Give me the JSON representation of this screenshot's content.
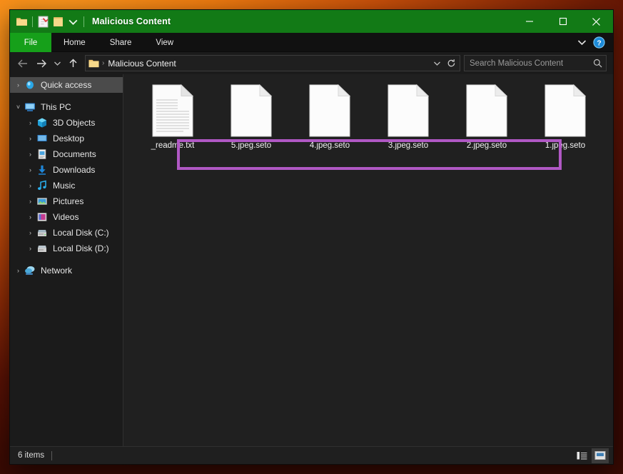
{
  "window": {
    "title": "Malicious Content",
    "accent_color": "#127a16",
    "quick_access_icons": [
      "folder-icon",
      "properties-icon",
      "new-folder-icon",
      "customize-chevron-icon"
    ],
    "controls": {
      "minimize": "minimize-icon",
      "maximize": "maximize-icon",
      "close": "close-icon"
    }
  },
  "ribbon": {
    "file_tab": "File",
    "tabs": [
      "Home",
      "Share",
      "View"
    ],
    "collapse_icon": "chevron-down-icon",
    "help_icon": "help-icon"
  },
  "addressbar": {
    "back_icon": "back-arrow-icon",
    "forward_icon": "forward-arrow-icon",
    "recent_icon": "recent-locations-chevron-icon",
    "up_icon": "up-arrow-icon",
    "folder_icon": "folder-icon",
    "crumb_separator": "›",
    "path": "Malicious Content",
    "dropdown_icon": "chevron-down-icon",
    "refresh_icon": "refresh-icon"
  },
  "search": {
    "placeholder": "Search Malicious Content",
    "icon": "search-icon"
  },
  "sidebar": {
    "items": [
      {
        "label": "Quick access",
        "icon": "quick-access-icon",
        "level": 1,
        "expander": "›",
        "selected": true
      },
      {
        "label": "This PC",
        "icon": "this-pc-icon",
        "level": 1,
        "expander": "˅",
        "selected": false
      },
      {
        "label": "3D Objects",
        "icon": "3d-objects-icon",
        "level": 2,
        "expander": "›",
        "selected": false
      },
      {
        "label": "Desktop",
        "icon": "desktop-icon",
        "level": 2,
        "expander": "›",
        "selected": false
      },
      {
        "label": "Documents",
        "icon": "documents-icon",
        "level": 2,
        "expander": "›",
        "selected": false
      },
      {
        "label": "Downloads",
        "icon": "downloads-icon",
        "level": 2,
        "expander": "›",
        "selected": false
      },
      {
        "label": "Music",
        "icon": "music-icon",
        "level": 2,
        "expander": "›",
        "selected": false
      },
      {
        "label": "Pictures",
        "icon": "pictures-icon",
        "level": 2,
        "expander": "›",
        "selected": false
      },
      {
        "label": "Videos",
        "icon": "videos-icon",
        "level": 2,
        "expander": "›",
        "selected": false
      },
      {
        "label": "Local Disk (C:)",
        "icon": "drive-icon",
        "level": 2,
        "expander": "›",
        "selected": false
      },
      {
        "label": "Local Disk (D:)",
        "icon": "drive-icon",
        "level": 2,
        "expander": "›",
        "selected": false
      },
      {
        "label": "Network",
        "icon": "network-icon",
        "level": 1,
        "expander": "›",
        "selected": false
      }
    ]
  },
  "files": [
    {
      "name": "_readme.txt",
      "icon": "text-file-icon",
      "highlighted": false
    },
    {
      "name": "5.jpeg.seto",
      "icon": "blank-file-icon",
      "highlighted": true
    },
    {
      "name": "4.jpeg.seto",
      "icon": "blank-file-icon",
      "highlighted": true
    },
    {
      "name": "3.jpeg.seto",
      "icon": "blank-file-icon",
      "highlighted": true
    },
    {
      "name": "2.jpeg.seto",
      "icon": "blank-file-icon",
      "highlighted": true
    },
    {
      "name": "1.jpeg.seto",
      "icon": "blank-file-icon",
      "highlighted": true
    }
  ],
  "annotation": {
    "type": "rectangle-highlight",
    "color": "#b058c4",
    "covers": [
      "5.jpeg.seto",
      "4.jpeg.seto",
      "3.jpeg.seto",
      "2.jpeg.seto",
      "1.jpeg.seto"
    ]
  },
  "statusbar": {
    "item_count": "6 items",
    "view_details_icon": "details-view-icon",
    "view_large_icons_icon": "large-icons-view-icon",
    "active_view": "large-icons-view-icon"
  }
}
